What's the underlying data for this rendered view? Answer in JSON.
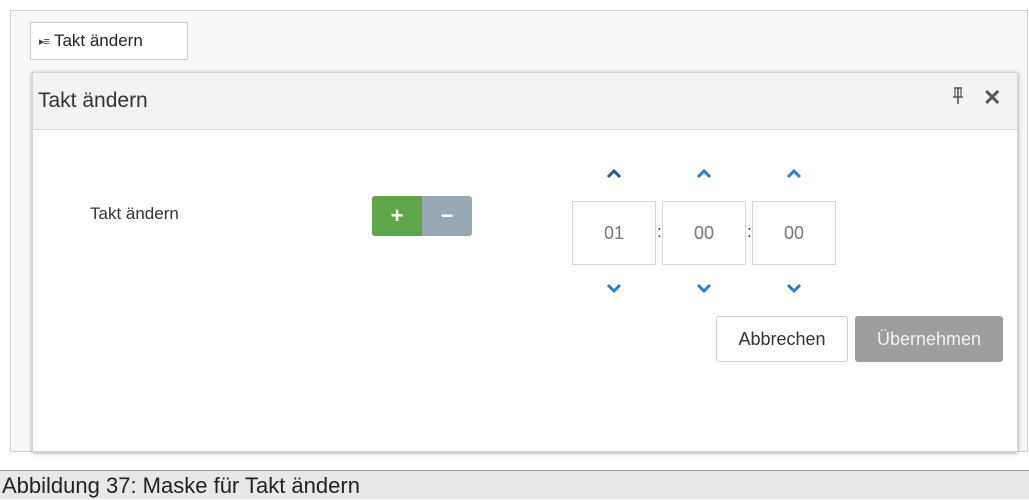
{
  "launcher": {
    "icon": "▸≡",
    "label": "Takt ändern"
  },
  "dialog": {
    "title": "Takt ändern",
    "pin_icon": "⊥",
    "close_icon": "✕"
  },
  "form": {
    "label": "Takt ändern",
    "plus_label": "+",
    "minus_label": "−"
  },
  "time": {
    "hours": "01",
    "minutes": "00",
    "seconds": "00",
    "separator": ":"
  },
  "buttons": {
    "cancel": "Abbrechen",
    "apply": "Übernehmen"
  },
  "caption": "Abbildung 37: Maske für Takt ändern",
  "colors": {
    "plus": "#5fa54a",
    "minus": "#9aa8b3",
    "arrow": "#2f7fc1",
    "apply_bg": "#9e9e9e"
  }
}
